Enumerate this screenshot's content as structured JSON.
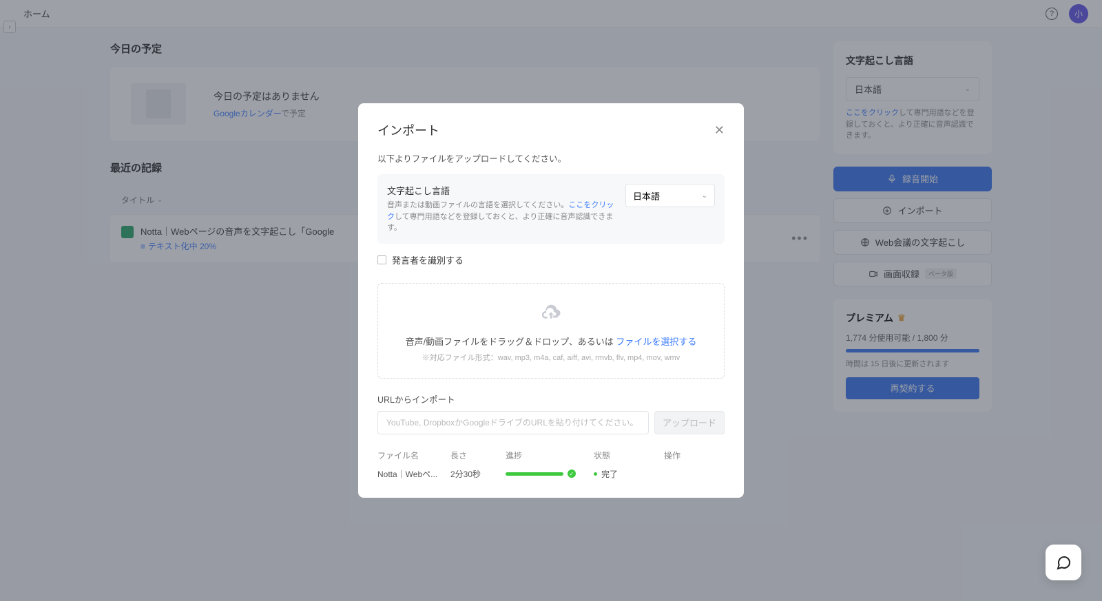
{
  "topbar": {
    "home": "ホーム",
    "avatar": "小"
  },
  "today": {
    "heading": "今日の予定",
    "empty_title": "今日の予定はありません",
    "calendar_link": "Googleカレンダー",
    "empty_suffix": "で予定"
  },
  "records": {
    "heading": "最近の記録",
    "col_title": "タイトル",
    "item": {
      "title": "Notta｜Webページの音声を文字起こし「Google",
      "status": "テキスト化中 20%"
    }
  },
  "side": {
    "lang_heading": "文字起こし言語",
    "lang_value": "日本語",
    "note_link": "ここをクリック",
    "note_rest": "して専門用語などを登録しておくと、より正確に音声認識できます。",
    "btn_record": "録音開始",
    "btn_import": "インポート",
    "btn_meeting": "Web会議の文字起こし",
    "btn_screen": "画面収録",
    "beta": "ベータ版",
    "premium": "プレミアム",
    "usage": "1,774 分使用可能 / 1,800 分",
    "renew_note": "時間は 15 日後に更新されます",
    "renew_btn": "再契約する"
  },
  "modal": {
    "title": "インポート",
    "subtitle": "以下よりファイルをアップロードしてください。",
    "lang_title": "文字起こし言語",
    "lang_desc_pre": "音声または動画ファイルの言語を選択してください。",
    "lang_desc_link": "ここをクリック",
    "lang_desc_post": "して専門用語などを登録しておくと、より正確に音声認識できます。",
    "lang_value": "日本語",
    "speaker_check": "発言者を識別する",
    "drop_text": "音声/動画ファイルをドラッグ＆ドロップ、あるいは ",
    "drop_link": "ファイルを選択する",
    "formats": "※対応ファイル形式：wav, mp3, m4a, caf, aiff, avi, rmvb, flv, mp4, mov, wmv",
    "url_label": "URLからインポート",
    "url_placeholder": "YouTube, DropboxかGoogleドライブのURLを貼り付けてください。",
    "upload_btn": "アップロード",
    "cols": {
      "name": "ファイル名",
      "len": "長さ",
      "prog": "進捗",
      "status": "状態",
      "action": "操作"
    },
    "file": {
      "name": "Notta｜Webペ...",
      "len": "2分30秒",
      "status": "完了"
    }
  }
}
